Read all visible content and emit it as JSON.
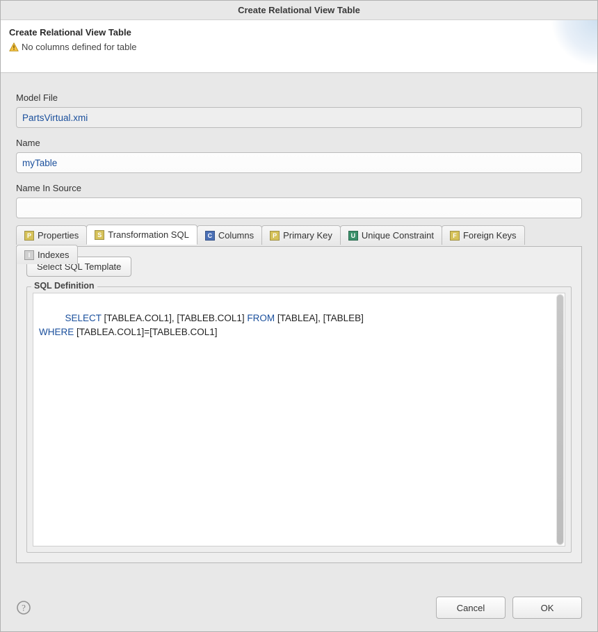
{
  "window": {
    "title": "Create Relational View Table"
  },
  "banner": {
    "heading": "Create Relational View Table",
    "message": "No columns defined for table"
  },
  "form": {
    "model_file_label": "Model File",
    "model_file_value": "PartsVirtual.xmi",
    "name_label": "Name",
    "name_value": "myTable",
    "name_in_source_label": "Name In Source",
    "name_in_source_value": ""
  },
  "tabs": {
    "properties": "Properties",
    "transformation_sql": "Transformation SQL",
    "columns": "Columns",
    "primary_key": "Primary Key",
    "unique_constraint": "Unique Constraint",
    "foreign_keys": "Foreign Keys",
    "indexes": "Indexes",
    "active": "transformation_sql"
  },
  "tab_icons": {
    "properties": "P",
    "transformation_sql": "S",
    "columns": "C",
    "primary_key": "P",
    "unique_constraint": "U",
    "foreign_keys": "F",
    "indexes": "I"
  },
  "tab_icon_colors": {
    "properties": "#d6c25a",
    "transformation_sql": "#d6c25a",
    "columns": "#4a6fb5",
    "primary_key": "#d6c25a",
    "unique_constraint": "#3a8f6a",
    "foreign_keys": "#d6c25a",
    "indexes": "#d0d0d0"
  },
  "transformation_panel": {
    "select_template_button": "Select SQL Template",
    "fieldset_title": "SQL Definition",
    "sql_tokens": [
      {
        "t": "SELECT",
        "kw": true
      },
      {
        "t": " [TABLEA.COL1], [TABLEB.COL1] ",
        "kw": false
      },
      {
        "t": "FROM",
        "kw": true
      },
      {
        "t": " [TABLEA], [TABLEB]\n",
        "kw": false
      },
      {
        "t": "WHERE",
        "kw": true
      },
      {
        "t": " [TABLEA.COL1]=[TABLEB.COL1]",
        "kw": false
      }
    ]
  },
  "footer": {
    "cancel": "Cancel",
    "ok": "OK"
  }
}
